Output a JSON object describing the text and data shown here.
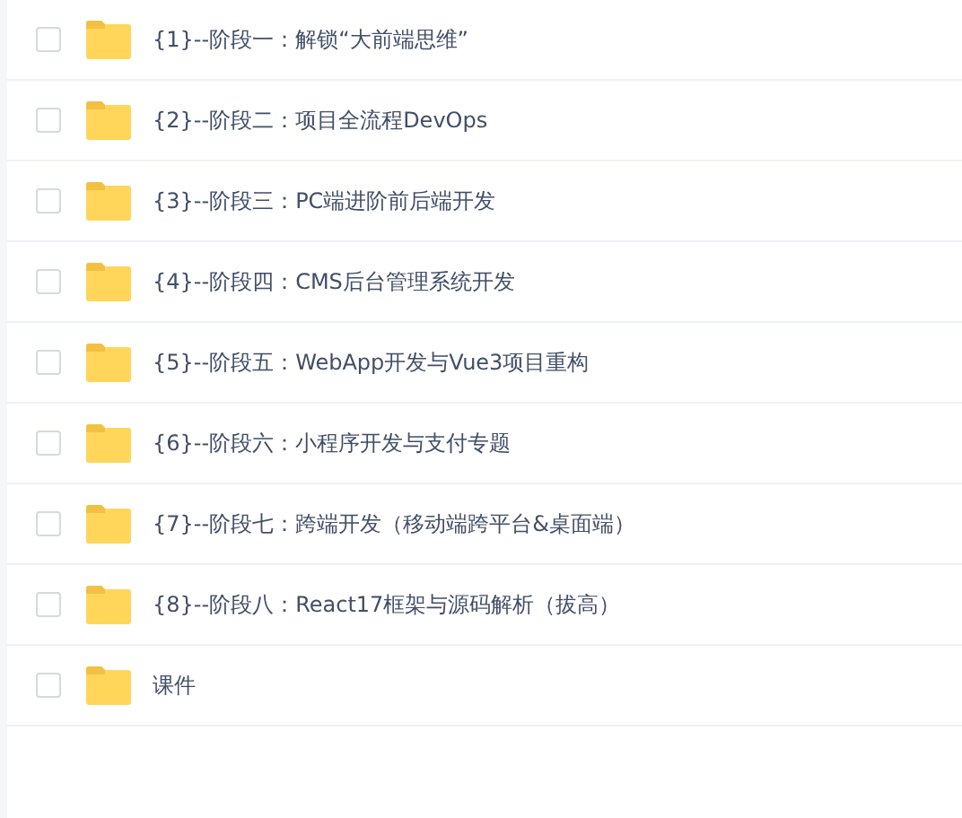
{
  "files": [
    {
      "name": "{1}--阶段一：解锁“大前端思维”",
      "checked": false
    },
    {
      "name": "{2}--阶段二：项目全流程DevOps",
      "checked": false
    },
    {
      "name": "{3}--阶段三：PC端进阶前后端开发",
      "checked": false
    },
    {
      "name": "{4}--阶段四：CMS后台管理系统开发",
      "checked": false
    },
    {
      "name": "{5}--阶段五：WebApp开发与Vue3项目重构",
      "checked": false
    },
    {
      "name": "{6}--阶段六：小程序开发与支付专题",
      "checked": false
    },
    {
      "name": "{7}--阶段七：跨端开发（移动端跨平台&桌面端）",
      "checked": false
    },
    {
      "name": "{8}--阶段八：React17框架与源码解析（拔高）",
      "checked": false
    },
    {
      "name": "课件",
      "checked": false
    }
  ]
}
